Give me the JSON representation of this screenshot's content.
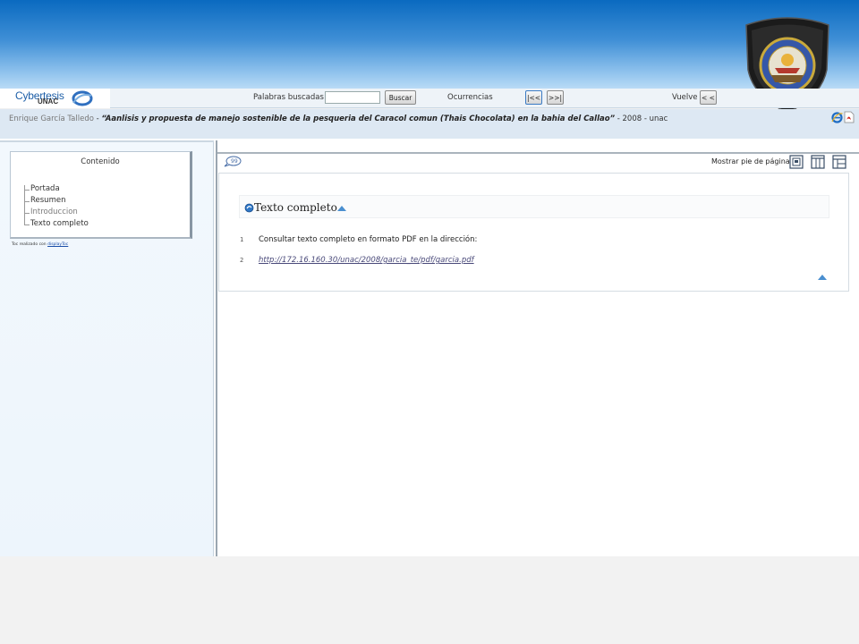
{
  "logo": {
    "brand": "Cybertesis",
    "sub": "UNAC"
  },
  "toolbar": {
    "search_label": "Palabras buscadas",
    "search_value": "",
    "search_button": "Buscar",
    "occurrences_label": "Ocurrencias",
    "first_button": "|<<",
    "next_button": ">>|",
    "back_label": "Vuelve",
    "back_button": "< <"
  },
  "record": {
    "author": "Enrique García Talledo",
    "separator1": " - ",
    "title": "“Aanlisis y propuesta de manejo sostenible de la pesqueria del Caracol comun (Thais Chocolata) en la bahia del Callao”",
    "rest": " - 2008 - unac"
  },
  "toc": {
    "title": "Contenido",
    "items": [
      {
        "label": "Portada"
      },
      {
        "label": "Resumen"
      },
      {
        "label": "Introduccion"
      },
      {
        "label": "Texto completo"
      }
    ],
    "note_prefix": "Toc realizado con ",
    "note_link": "displayToc"
  },
  "viewer": {
    "footer_toggle": "Mostrar pie de páginas",
    "section_title": "Texto completo",
    "lines": [
      {
        "num": "1",
        "text": "Consultar texto completo en formato PDF en la dirección:"
      },
      {
        "num": "2",
        "text": "http://172.16.160.30/unac/2008/garcia_te/pdf/garcia.pdf"
      }
    ]
  },
  "icons": {
    "crest": "university-crest-icon",
    "ie": "internet-explorer-icon",
    "pdf": "pdf-icon",
    "speech": "speech-bubble-icon",
    "views": [
      "single-page-view-icon",
      "two-column-view-icon",
      "frame-view-icon"
    ]
  },
  "colors": {
    "banner_top": "#0a6ac0",
    "banner_bottom": "#b9dbf6",
    "link": "#4a4a7a",
    "accent": "#4a8fd0"
  }
}
